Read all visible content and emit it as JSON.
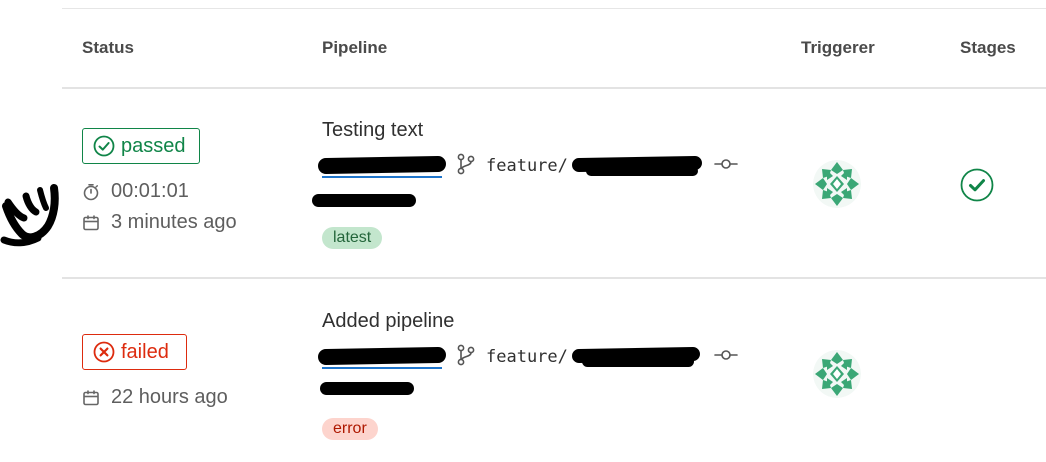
{
  "table": {
    "headers": {
      "status": "Status",
      "pipeline": "Pipeline",
      "triggerer": "Triggerer",
      "stages": "Stages"
    },
    "rows": [
      {
        "status": "passed",
        "status_icon": "check-circle-icon",
        "duration": "00:01:01",
        "finished": "3 minutes ago",
        "title": "Testing text",
        "branch_prefix": "feature/",
        "tag": "latest",
        "triggerer_avatar": "identicon-avatar",
        "stage_status": "passed",
        "stage_icon": "check-circle-icon"
      },
      {
        "status": "failed",
        "status_icon": "x-circle-icon",
        "finished": "22 hours ago",
        "title": "Added pipeline",
        "branch_prefix": "feature/",
        "tag": "error",
        "triggerer_avatar": "identicon-avatar"
      }
    ]
  },
  "colors": {
    "success": "#108548",
    "danger": "#dd2b0e",
    "link": "#1f75cb",
    "latest_bg": "#c3e6cd",
    "error_bg": "#fdd4cd",
    "avatar": "#3ba776"
  },
  "redactions": "black marker over pipeline id, commit sha and branch suffix"
}
